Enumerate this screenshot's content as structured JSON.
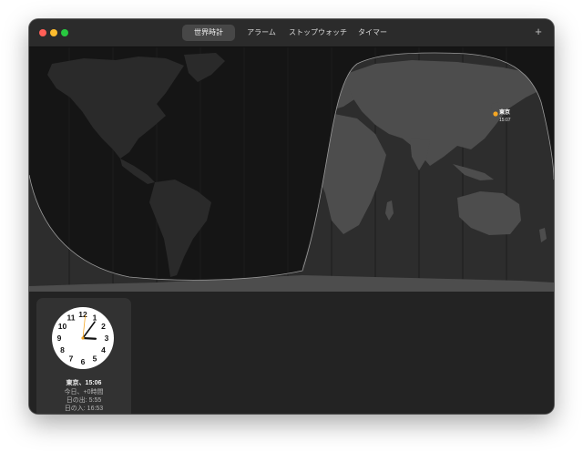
{
  "app": {
    "tabs": [
      {
        "label": "世界時計",
        "active": true
      },
      {
        "label": "アラーム",
        "active": false
      },
      {
        "label": "ストップウォッチ",
        "active": false
      },
      {
        "label": "タイマー",
        "active": false
      }
    ],
    "add_icon": "plus-icon",
    "add_glyph": "+"
  },
  "map": {
    "pin": {
      "city": "東京",
      "time": "15:07",
      "color": "#f5a623"
    }
  },
  "clock_card": {
    "city_time": "東京、15:06",
    "day_offset": "今日、+0時間",
    "sunrise": "日の出: 5:55",
    "sunset": "日の入: 16:53",
    "clock": {
      "hour": 15,
      "minute": 6,
      "second": 1,
      "numbers": [
        "12",
        "1",
        "2",
        "3",
        "4",
        "5",
        "6",
        "7",
        "8",
        "9",
        "10",
        "11"
      ],
      "second_hand_color": "#f5a623"
    }
  },
  "colors": {
    "window_bg": "#232323",
    "night": "#151515",
    "day": "#2e2e2e",
    "land_night": "#2a2a2a",
    "land_day": "#4a4a4a"
  }
}
